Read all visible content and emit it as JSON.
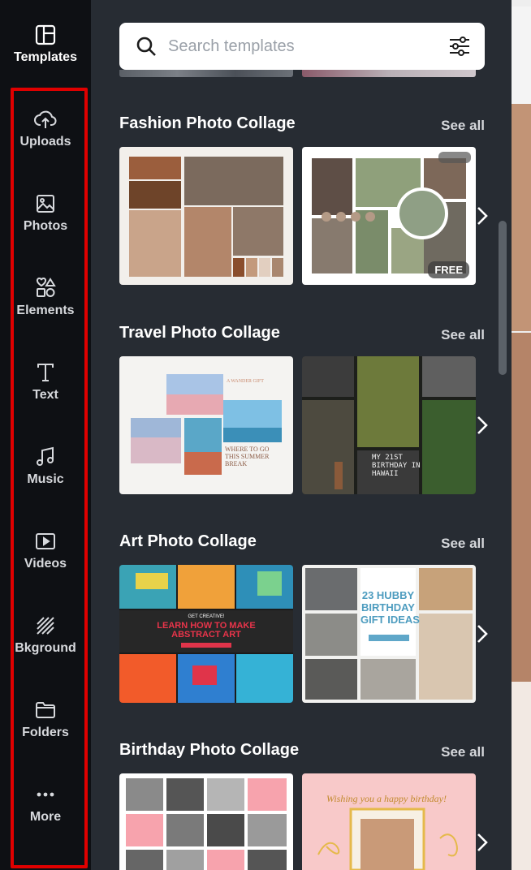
{
  "sidebar": {
    "items": [
      {
        "label": "Templates",
        "icon": "templates-icon"
      },
      {
        "label": "Uploads",
        "icon": "cloud-upload-icon"
      },
      {
        "label": "Photos",
        "icon": "photo-icon"
      },
      {
        "label": "Elements",
        "icon": "shapes-icon"
      },
      {
        "label": "Text",
        "icon": "text-icon"
      },
      {
        "label": "Music",
        "icon": "music-note-icon"
      },
      {
        "label": "Videos",
        "icon": "video-play-icon"
      },
      {
        "label": "Bkground",
        "icon": "background-pattern-icon"
      },
      {
        "label": "Folders",
        "icon": "folder-icon"
      },
      {
        "label": "More",
        "icon": "more-dots-icon"
      }
    ],
    "highlight_color": "#e00000"
  },
  "search": {
    "placeholder": "Search templates"
  },
  "sections": [
    {
      "title": "Fashion Photo Collage",
      "see_all": "See all",
      "badge": "FREE"
    },
    {
      "title": "Travel Photo Collage",
      "see_all": "See all",
      "card1_text": {
        "small": "A WANDER GIFT",
        "main": "WHERE TO GO\nTHIS SUMMER\nBREAK"
      },
      "card2_text": "MY 21ST\nBIRTHDAY IN\nHAWAII"
    },
    {
      "title": "Art Photo Collage",
      "see_all": "See all",
      "card1_text": {
        "small": "GET CREATIVE!",
        "main": "LEARN HOW TO MAKE\nABSTRACT ART"
      },
      "card2_text": "23 HUBBY\nBIRTHDAY\nGIFT IDEAS"
    },
    {
      "title": "Birthday Photo Collage",
      "see_all": "See all",
      "card2_text": "Wishing you a happy birthday!"
    }
  ],
  "colors": {
    "panel_bg": "#272c33",
    "rail_bg": "#0e1014",
    "accent_red": "#e00000"
  }
}
